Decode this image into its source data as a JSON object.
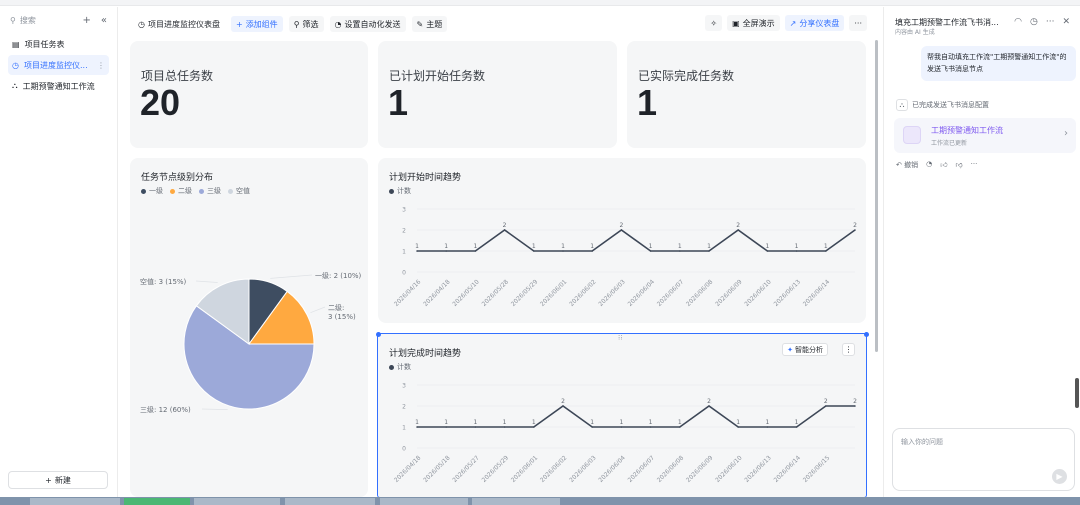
{
  "sidebar": {
    "search_placeholder": "搜索",
    "items": [
      {
        "label": "项目任务表",
        "icon": "table-icon"
      },
      {
        "label": "项目进度监控仪...",
        "icon": "dashboard-icon",
        "active": true
      },
      {
        "label": "工期预警通知工作流",
        "icon": "workflow-icon"
      }
    ],
    "new_label": "新建"
  },
  "toolbar": {
    "dashboard_title": "项目进度监控仪表盘",
    "add_widget": "添加组件",
    "filter": "筛选",
    "auto_send": "设置自动化发送",
    "theme": "主题",
    "fullscreen": "全屏演示",
    "share": "分享仪表盘",
    "more": "···"
  },
  "stats": [
    {
      "label": "项目总任务数",
      "value": "20"
    },
    {
      "label": "已计划开始任务数",
      "value": "1"
    },
    {
      "label": "已实际完成任务数",
      "value": "1"
    }
  ],
  "colors": {
    "accent": "#3370ff",
    "line": "#3d4757",
    "level1": "#3e4d61",
    "level2": "#ffa940",
    "level3": "#9ca9d9",
    "empty": "#cfd6df"
  },
  "chart_data": [
    {
      "type": "pie",
      "title": "任务节点级别分布",
      "legend": [
        "一级",
        "二级",
        "三级",
        "空值"
      ],
      "legend_placement": "top-left",
      "slices": [
        {
          "name": "一级",
          "value": 2,
          "percent": 10,
          "label": "一级: 2 (10%)",
          "color": "#3e4d61"
        },
        {
          "name": "二级",
          "value": 3,
          "percent": 15,
          "label": "二级: 3 (15%)",
          "color": "#ffa940"
        },
        {
          "name": "三级",
          "value": 12,
          "percent": 60,
          "label": "三级: 12 (60%)",
          "color": "#9ca9d9"
        },
        {
          "name": "空值",
          "value": 3,
          "percent": 15,
          "label": "空值: 3 (15%)",
          "color": "#cfd6df"
        }
      ]
    },
    {
      "type": "line",
      "title": "计划开始时间趋势",
      "legend": [
        "计数"
      ],
      "ylim": [
        0,
        3
      ],
      "yticks": [
        "0",
        "1",
        "2",
        "3"
      ],
      "grid": true,
      "x": [
        "2026/04/16",
        "2026/04/18",
        "2026/05/10",
        "2026/05/28",
        "2026/05/29",
        "2026/06/01",
        "2026/06/02",
        "2026/06/03",
        "2026/06/04",
        "2026/06/07",
        "2026/06/08",
        "2026/06/09",
        "2026/06/10",
        "2026/06/13",
        "2026/06/14"
      ],
      "series": [
        {
          "name": "计数",
          "values": [
            1,
            1,
            1,
            2,
            1,
            1,
            1,
            2,
            1,
            1,
            1,
            2,
            1,
            1,
            1,
            2
          ]
        }
      ]
    },
    {
      "type": "line",
      "title": "计划完成时间趋势",
      "legend": [
        "计数"
      ],
      "ylim": [
        0,
        3
      ],
      "yticks": [
        "0",
        "1",
        "2",
        "3"
      ],
      "grid": true,
      "x": [
        "2026/04/18",
        "2026/05/18",
        "2026/05/27",
        "2026/05/29",
        "2026/06/01",
        "2026/06/02",
        "2026/06/03",
        "2026/06/04",
        "2026/06/07",
        "2026/06/08",
        "2026/06/09",
        "2026/06/10",
        "2026/06/13",
        "2026/06/14",
        "2026/06/15"
      ],
      "series": [
        {
          "name": "计数",
          "values": [
            1,
            1,
            1,
            1,
            1,
            2,
            1,
            1,
            1,
            1,
            2,
            1,
            1,
            1,
            2,
            2
          ]
        }
      ],
      "ai_button": "智能分析"
    }
  ],
  "assistant": {
    "title": "填充工期预警工作流飞书消...",
    "subtitle": "内容由 AI 生成",
    "user_message": "帮我自动填充工作流\"工期预警通知工作流\"的发送飞书消息节点",
    "status": "已完成发送飞书消息配置",
    "workflow_title": "工期预警通知工作流",
    "workflow_sub": "工作流已更新",
    "undo": "撤销",
    "input_placeholder": "输入你的问题"
  }
}
